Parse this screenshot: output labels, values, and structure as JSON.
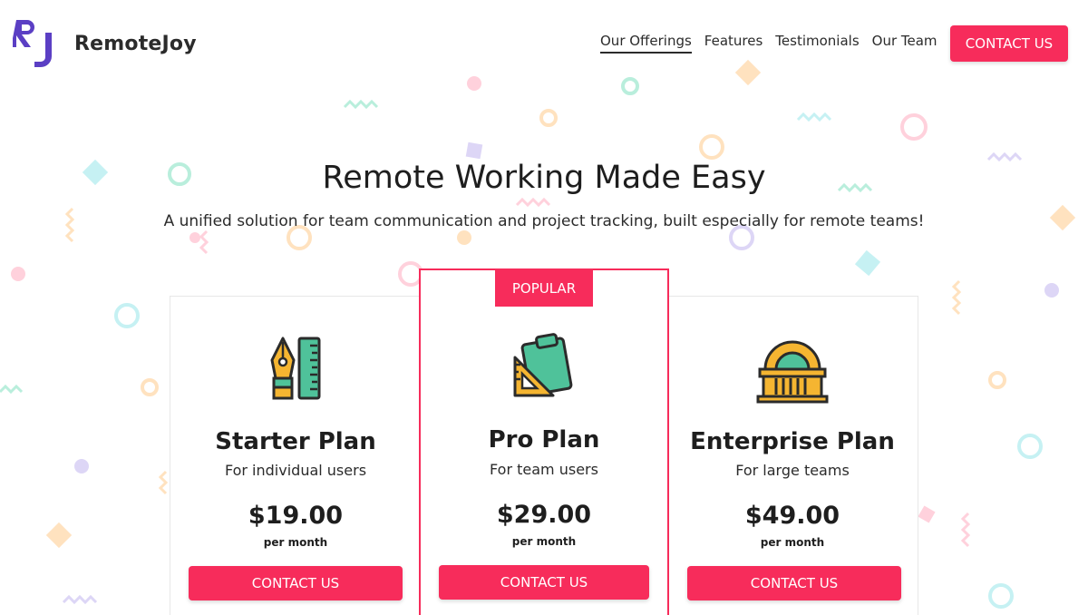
{
  "brand": {
    "name": "RemoteJoy",
    "logo_initials": "RJ",
    "accent": "#f72c5b",
    "logo_color": "#5b3fc4"
  },
  "nav": {
    "items": [
      {
        "label": "Our Offerings",
        "active": true
      },
      {
        "label": "Features",
        "active": false
      },
      {
        "label": "Testimonials",
        "active": false
      },
      {
        "label": "Our Team",
        "active": false
      }
    ],
    "cta_label": "CONTACT US"
  },
  "hero": {
    "title": "Remote Working Made Easy",
    "subtitle": "A unified solution for team communication and project tracking, built especially for remote teams!"
  },
  "plans": [
    {
      "icon": "pen-ruler-icon",
      "name": "Starter Plan",
      "description": "For individual users",
      "price": "$19.00",
      "period": "per month",
      "button_label": "CONTACT US",
      "featured": false
    },
    {
      "icon": "clipboard-set-square-icon",
      "name": "Pro Plan",
      "description": "For team users",
      "price": "$29.00",
      "period": "per month",
      "button_label": "CONTACT US",
      "featured": true,
      "badge": "POPULAR"
    },
    {
      "icon": "building-icon",
      "name": "Enterprise Plan",
      "description": "For large teams",
      "price": "$49.00",
      "period": "per month",
      "button_label": "CONTACT US",
      "featured": false
    }
  ]
}
